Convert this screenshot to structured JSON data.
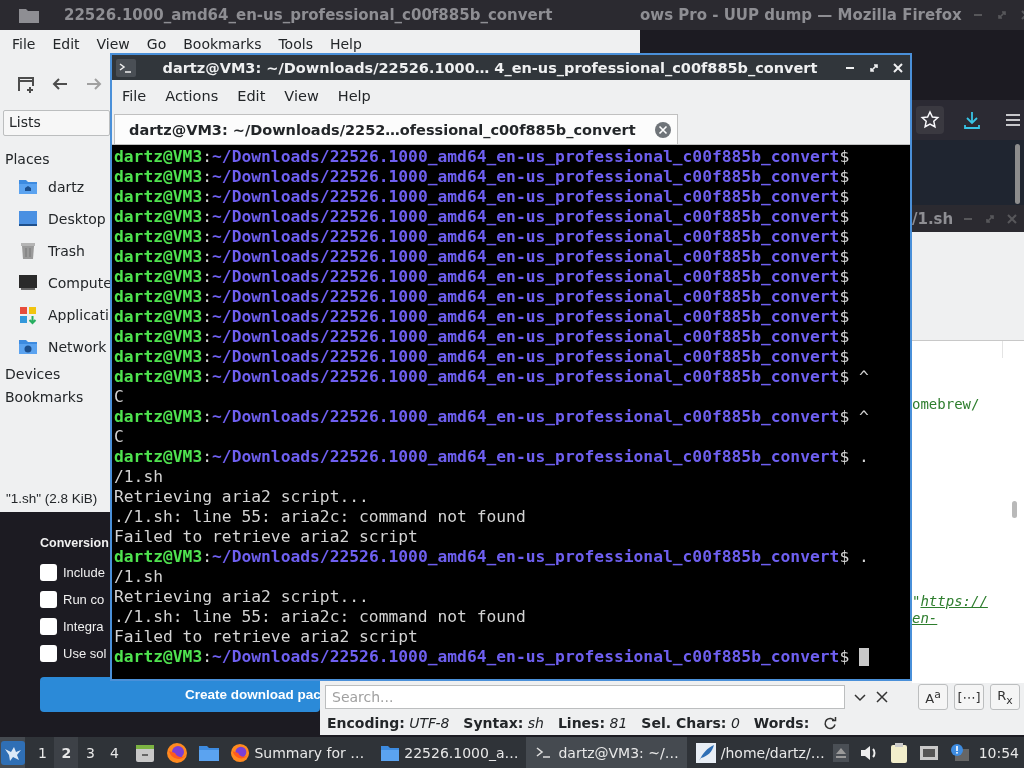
{
  "browser": {
    "title": "ows Pro - UUP dump — Mozilla Firefox",
    "page": {
      "heading": "Conversion",
      "options": [
        {
          "label": "Include",
          "checked": false
        },
        {
          "label": "Run co",
          "checked": false
        },
        {
          "label": "Integra",
          "checked": false
        },
        {
          "label": "Use sol",
          "checked": false
        }
      ],
      "button": "Create download pac"
    }
  },
  "file_manager": {
    "title": "22526.1000_amd64_en-us_professional_c00f885b_convert",
    "menu": [
      "File",
      "Edit",
      "View",
      "Go",
      "Bookmarks",
      "Tools",
      "Help"
    ],
    "view_selector": "Lists",
    "sidebar": [
      {
        "kind": "heading",
        "label": "Places"
      },
      {
        "kind": "place",
        "label": "dartz"
      },
      {
        "kind": "place",
        "label": "Desktop"
      },
      {
        "kind": "place",
        "label": "Trash"
      },
      {
        "kind": "place",
        "label": "Compute"
      },
      {
        "kind": "place",
        "label": "Applicati"
      },
      {
        "kind": "place",
        "label": "Network"
      },
      {
        "kind": "heading",
        "label": "Devices"
      },
      {
        "kind": "heading",
        "label": "Bookmarks"
      }
    ],
    "status": "\"1.sh\" (2.8 KiB)"
  },
  "editor": {
    "title": "/1.sh",
    "code_lines": [
      {
        "text": "omebrew/"
      },
      {
        "text": "\"",
        "link": "https://"
      },
      {
        "link": "en-"
      }
    ],
    "search": {
      "placeholder": "Search...",
      "toggles": [
        "A$^{a}$",
        "[⋯]",
        "R$_{x}$"
      ]
    },
    "status": [
      {
        "label": "Encoding:",
        "value": "UTF-8"
      },
      {
        "label": "Syntax:",
        "value": "sh"
      },
      {
        "label": "Lines:",
        "value": "81"
      },
      {
        "label": "Sel. Chars:",
        "value": "0"
      },
      {
        "label": "Words:"
      }
    ]
  },
  "terminal": {
    "title": "dartz@VM3: ~/Downloads/22526.1000… 4_en-us_professional_c00f885b_convert",
    "menu": [
      "File",
      "Actions",
      "Edit",
      "View",
      "Help"
    ],
    "tabs": [
      {
        "label": "dartz@VM3: ~/Downloads/2252…ofessional_c00f885b_convert",
        "selected": true
      }
    ],
    "lines": [
      {
        "kind": "prompt",
        "user": "dartz@VM3",
        "sep": ":",
        "path": "~/Downloads/22526.1000_amd64_en-us_professional_c00f885b_convert",
        "sigil": "$"
      },
      {
        "kind": "prompt",
        "user": "dartz@VM3",
        "sep": ":",
        "path": "~/Downloads/22526.1000_amd64_en-us_professional_c00f885b_convert",
        "sigil": "$"
      },
      {
        "kind": "prompt",
        "user": "dartz@VM3",
        "sep": ":",
        "path": "~/Downloads/22526.1000_amd64_en-us_professional_c00f885b_convert",
        "sigil": "$"
      },
      {
        "kind": "prompt",
        "user": "dartz@VM3",
        "sep": ":",
        "path": "~/Downloads/22526.1000_amd64_en-us_professional_c00f885b_convert",
        "sigil": "$"
      },
      {
        "kind": "prompt",
        "user": "dartz@VM3",
        "sep": ":",
        "path": "~/Downloads/22526.1000_amd64_en-us_professional_c00f885b_convert",
        "sigil": "$"
      },
      {
        "kind": "prompt",
        "user": "dartz@VM3",
        "sep": ":",
        "path": "~/Downloads/22526.1000_amd64_en-us_professional_c00f885b_convert",
        "sigil": "$"
      },
      {
        "kind": "prompt",
        "user": "dartz@VM3",
        "sep": ":",
        "path": "~/Downloads/22526.1000_amd64_en-us_professional_c00f885b_convert",
        "sigil": "$"
      },
      {
        "kind": "prompt",
        "user": "dartz@VM3",
        "sep": ":",
        "path": "~/Downloads/22526.1000_amd64_en-us_professional_c00f885b_convert",
        "sigil": "$"
      },
      {
        "kind": "prompt",
        "user": "dartz@VM3",
        "sep": ":",
        "path": "~/Downloads/22526.1000_amd64_en-us_professional_c00f885b_convert",
        "sigil": "$"
      },
      {
        "kind": "prompt",
        "user": "dartz@VM3",
        "sep": ":",
        "path": "~/Downloads/22526.1000_amd64_en-us_professional_c00f885b_convert",
        "sigil": "$"
      },
      {
        "kind": "prompt",
        "user": "dartz@VM3",
        "sep": ":",
        "path": "~/Downloads/22526.1000_amd64_en-us_professional_c00f885b_convert",
        "sigil": "$"
      },
      {
        "kind": "prompt",
        "user": "dartz@VM3",
        "sep": ":",
        "path": "~/Downloads/22526.1000_amd64_en-us_professional_c00f885b_convert",
        "sigil": "$",
        "input": "^"
      },
      {
        "kind": "output",
        "text": "C"
      },
      {
        "kind": "prompt",
        "user": "dartz@VM3",
        "sep": ":",
        "path": "~/Downloads/22526.1000_amd64_en-us_professional_c00f885b_convert",
        "sigil": "$",
        "input": "^"
      },
      {
        "kind": "output",
        "text": "C"
      },
      {
        "kind": "prompt",
        "user": "dartz@VM3",
        "sep": ":",
        "path": "~/Downloads/22526.1000_amd64_en-us_professional_c00f885b_convert",
        "sigil": "$",
        "input": "."
      },
      {
        "kind": "output",
        "text": "/1.sh"
      },
      {
        "kind": "output",
        "text": "Retrieving aria2 script..."
      },
      {
        "kind": "output",
        "text": "./1.sh: line 55: aria2c: command not found"
      },
      {
        "kind": "output",
        "text": "Failed to retrieve aria2 script"
      },
      {
        "kind": "prompt",
        "user": "dartz@VM3",
        "sep": ":",
        "path": "~/Downloads/22526.1000_amd64_en-us_professional_c00f885b_convert",
        "sigil": "$",
        "input": "."
      },
      {
        "kind": "output",
        "text": "/1.sh"
      },
      {
        "kind": "output",
        "text": "Retrieving aria2 script..."
      },
      {
        "kind": "output",
        "text": "./1.sh: line 55: aria2c: command not found"
      },
      {
        "kind": "output",
        "text": "Failed to retrieve aria2 script"
      },
      {
        "kind": "prompt",
        "user": "dartz@VM3",
        "sep": ":",
        "path": "~/Downloads/22526.1000_amd64_en-us_professional_c00f885b_convert",
        "sigil": "$"
      }
    ]
  },
  "taskbar": {
    "workspaces": [
      {
        "label": "1",
        "selected": false
      },
      {
        "label": "2",
        "selected": true
      },
      {
        "label": "3",
        "selected": false
      },
      {
        "label": "4",
        "selected": false
      }
    ],
    "tasks": [
      {
        "label": "Summary for …",
        "selected": false
      },
      {
        "label": "22526.1000_a…",
        "selected": false
      },
      {
        "label": "dartz@VM3: ~/…",
        "selected": true
      },
      {
        "label": "/home/dartz/…",
        "selected": false
      }
    ],
    "clock": "10:54"
  }
}
